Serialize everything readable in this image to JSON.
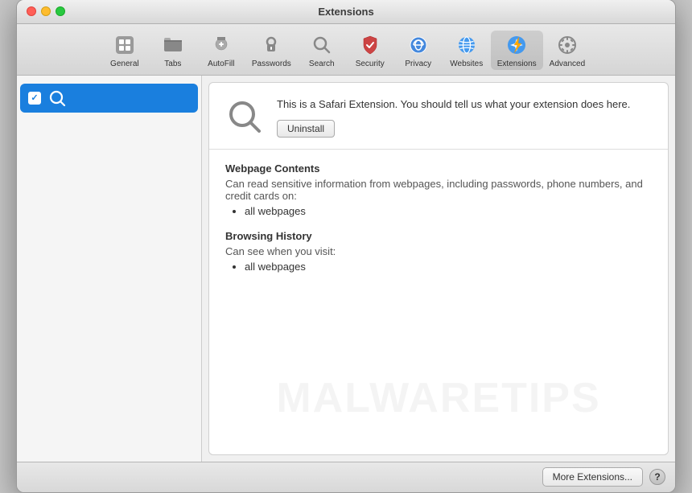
{
  "window": {
    "title": "Extensions"
  },
  "traffic_lights": {
    "close_label": "close",
    "minimize_label": "minimize",
    "maximize_label": "maximize"
  },
  "toolbar": {
    "items": [
      {
        "id": "general",
        "label": "General",
        "icon": "general"
      },
      {
        "id": "tabs",
        "label": "Tabs",
        "icon": "tabs"
      },
      {
        "id": "autofill",
        "label": "AutoFill",
        "icon": "autofill"
      },
      {
        "id": "passwords",
        "label": "Passwords",
        "icon": "passwords"
      },
      {
        "id": "search",
        "label": "Search",
        "icon": "search"
      },
      {
        "id": "security",
        "label": "Security",
        "icon": "security"
      },
      {
        "id": "privacy",
        "label": "Privacy",
        "icon": "privacy"
      },
      {
        "id": "websites",
        "label": "Websites",
        "icon": "websites"
      },
      {
        "id": "extensions",
        "label": "Extensions",
        "icon": "extensions",
        "active": true
      },
      {
        "id": "advanced",
        "label": "Advanced",
        "icon": "advanced"
      }
    ]
  },
  "sidebar": {
    "items": [
      {
        "id": "search-ext",
        "label": "Search",
        "checked": true,
        "selected": true
      }
    ]
  },
  "detail": {
    "extension_description": "This is a Safari Extension. You should tell us what your extension does here.",
    "uninstall_label": "Uninstall",
    "sections": [
      {
        "title": "Webpage Contents",
        "description": "Can read sensitive information from webpages, including passwords, phone numbers, and credit cards on:",
        "items": [
          "all webpages"
        ]
      },
      {
        "title": "Browsing History",
        "description": "Can see when you visit:",
        "items": [
          "all webpages"
        ]
      }
    ]
  },
  "bottom_bar": {
    "more_extensions_label": "More Extensions...",
    "help_label": "?"
  },
  "watermark": {
    "text": "MALWARETIPS"
  }
}
